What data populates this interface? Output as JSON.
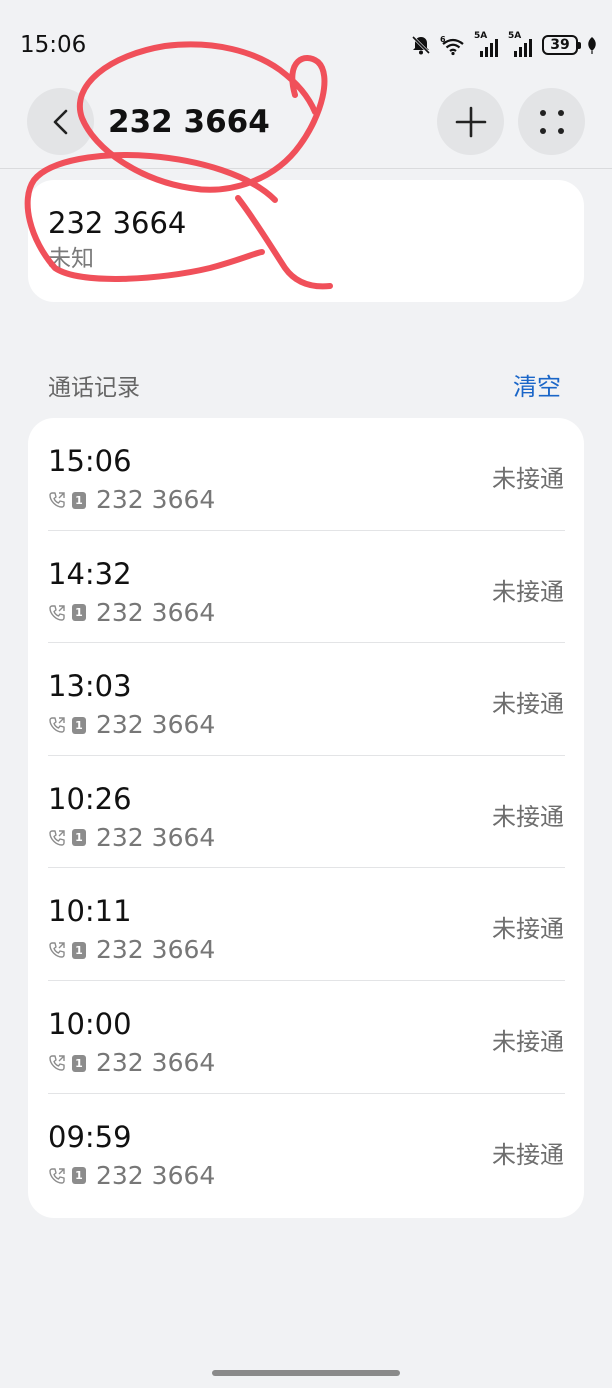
{
  "status_bar": {
    "time": "15:06",
    "network_tag_1": "5A",
    "network_tag_2": "5A",
    "battery": "39",
    "icons": [
      "bell-muted-icon",
      "wifi-icon",
      "signal-icon",
      "signal-icon",
      "battery-icon",
      "leaf-icon"
    ]
  },
  "header": {
    "title": "232 3664",
    "back_icon": "chevron-left-icon",
    "add_icon": "plus-icon",
    "more_icon": "four-dots-icon"
  },
  "contact": {
    "number": "232 3664",
    "location": "未知"
  },
  "call_log": {
    "section_title": "通话记录",
    "clear_label": "清空",
    "records": [
      {
        "time": "15:06",
        "sim": "1",
        "number": "232 3664",
        "status": "未接通"
      },
      {
        "time": "14:32",
        "sim": "1",
        "number": "232 3664",
        "status": "未接通"
      },
      {
        "time": "13:03",
        "sim": "1",
        "number": "232 3664",
        "status": "未接通"
      },
      {
        "time": "10:26",
        "sim": "1",
        "number": "232 3664",
        "status": "未接通"
      },
      {
        "time": "10:11",
        "sim": "1",
        "number": "232 3664",
        "status": "未接通"
      },
      {
        "time": "10:00",
        "sim": "1",
        "number": "232 3664",
        "status": "未接通"
      },
      {
        "time": "09:59",
        "sim": "1",
        "number": "232 3664",
        "status": "未接通"
      }
    ]
  },
  "colors": {
    "background": "#f1f2f4",
    "card": "#ffffff",
    "accent": "#1a66c8",
    "annotation": "#f0505a"
  }
}
